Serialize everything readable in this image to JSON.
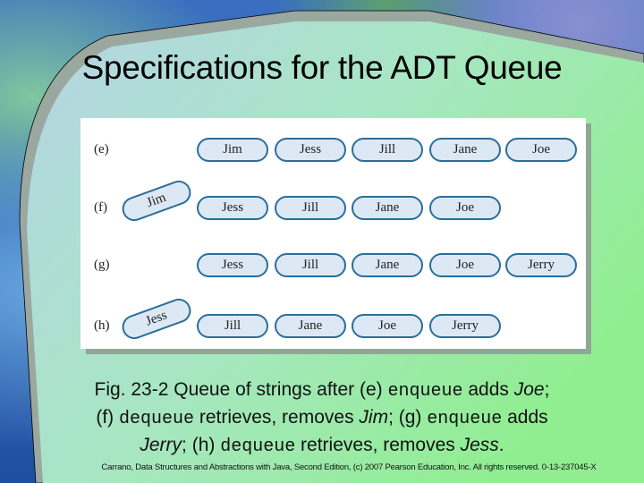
{
  "slide": {
    "title": "Specifications for the ADT Queue",
    "colors": {
      "content_gradient_start": "#b6d4e6",
      "content_gradient_end": "#90ee90",
      "pill_fill": "#dde8f5",
      "pill_border": "#2a6e9a",
      "panel_bg": "#ffffff"
    }
  },
  "figure": {
    "rows": [
      {
        "label": "(e)",
        "removed": null,
        "queue": [
          "Jim",
          "Jess",
          "Jill",
          "Jane",
          "Joe"
        ]
      },
      {
        "label": "(f)",
        "removed": "Jim",
        "queue": [
          "Jess",
          "Jill",
          "Jane",
          "Joe"
        ]
      },
      {
        "label": "(g)",
        "removed": null,
        "queue": [
          "Jess",
          "Jill",
          "Jane",
          "Joe",
          "Jerry"
        ]
      },
      {
        "label": "(h)",
        "removed": "Jess",
        "queue": [
          "Jill",
          "Jane",
          "Joe",
          "Jerry"
        ]
      }
    ]
  },
  "caption": {
    "p1": "Fig. 23-2 Queue of strings after (e) ",
    "code1": "enqueue",
    "p2": " adds ",
    "i1": "Joe",
    "p3": ";",
    "p4": "(f) ",
    "code2": "dequeue",
    "p5": " retrieves, removes ",
    "i2": "Jim",
    "p6": "; (g) ",
    "code3": "enqueue",
    "p7": " adds",
    "i3": "Jerry",
    "p8": "; (h) ",
    "code4": "dequeue",
    "p9": " retrieves, removes ",
    "i4": "Jess",
    "p10": "."
  },
  "footer": "Carrano, Data Structures and Abstractions with Java, Second Edition, (c) 2007 Pearson Education, Inc. All rights reserved. 0-13-237045-X"
}
